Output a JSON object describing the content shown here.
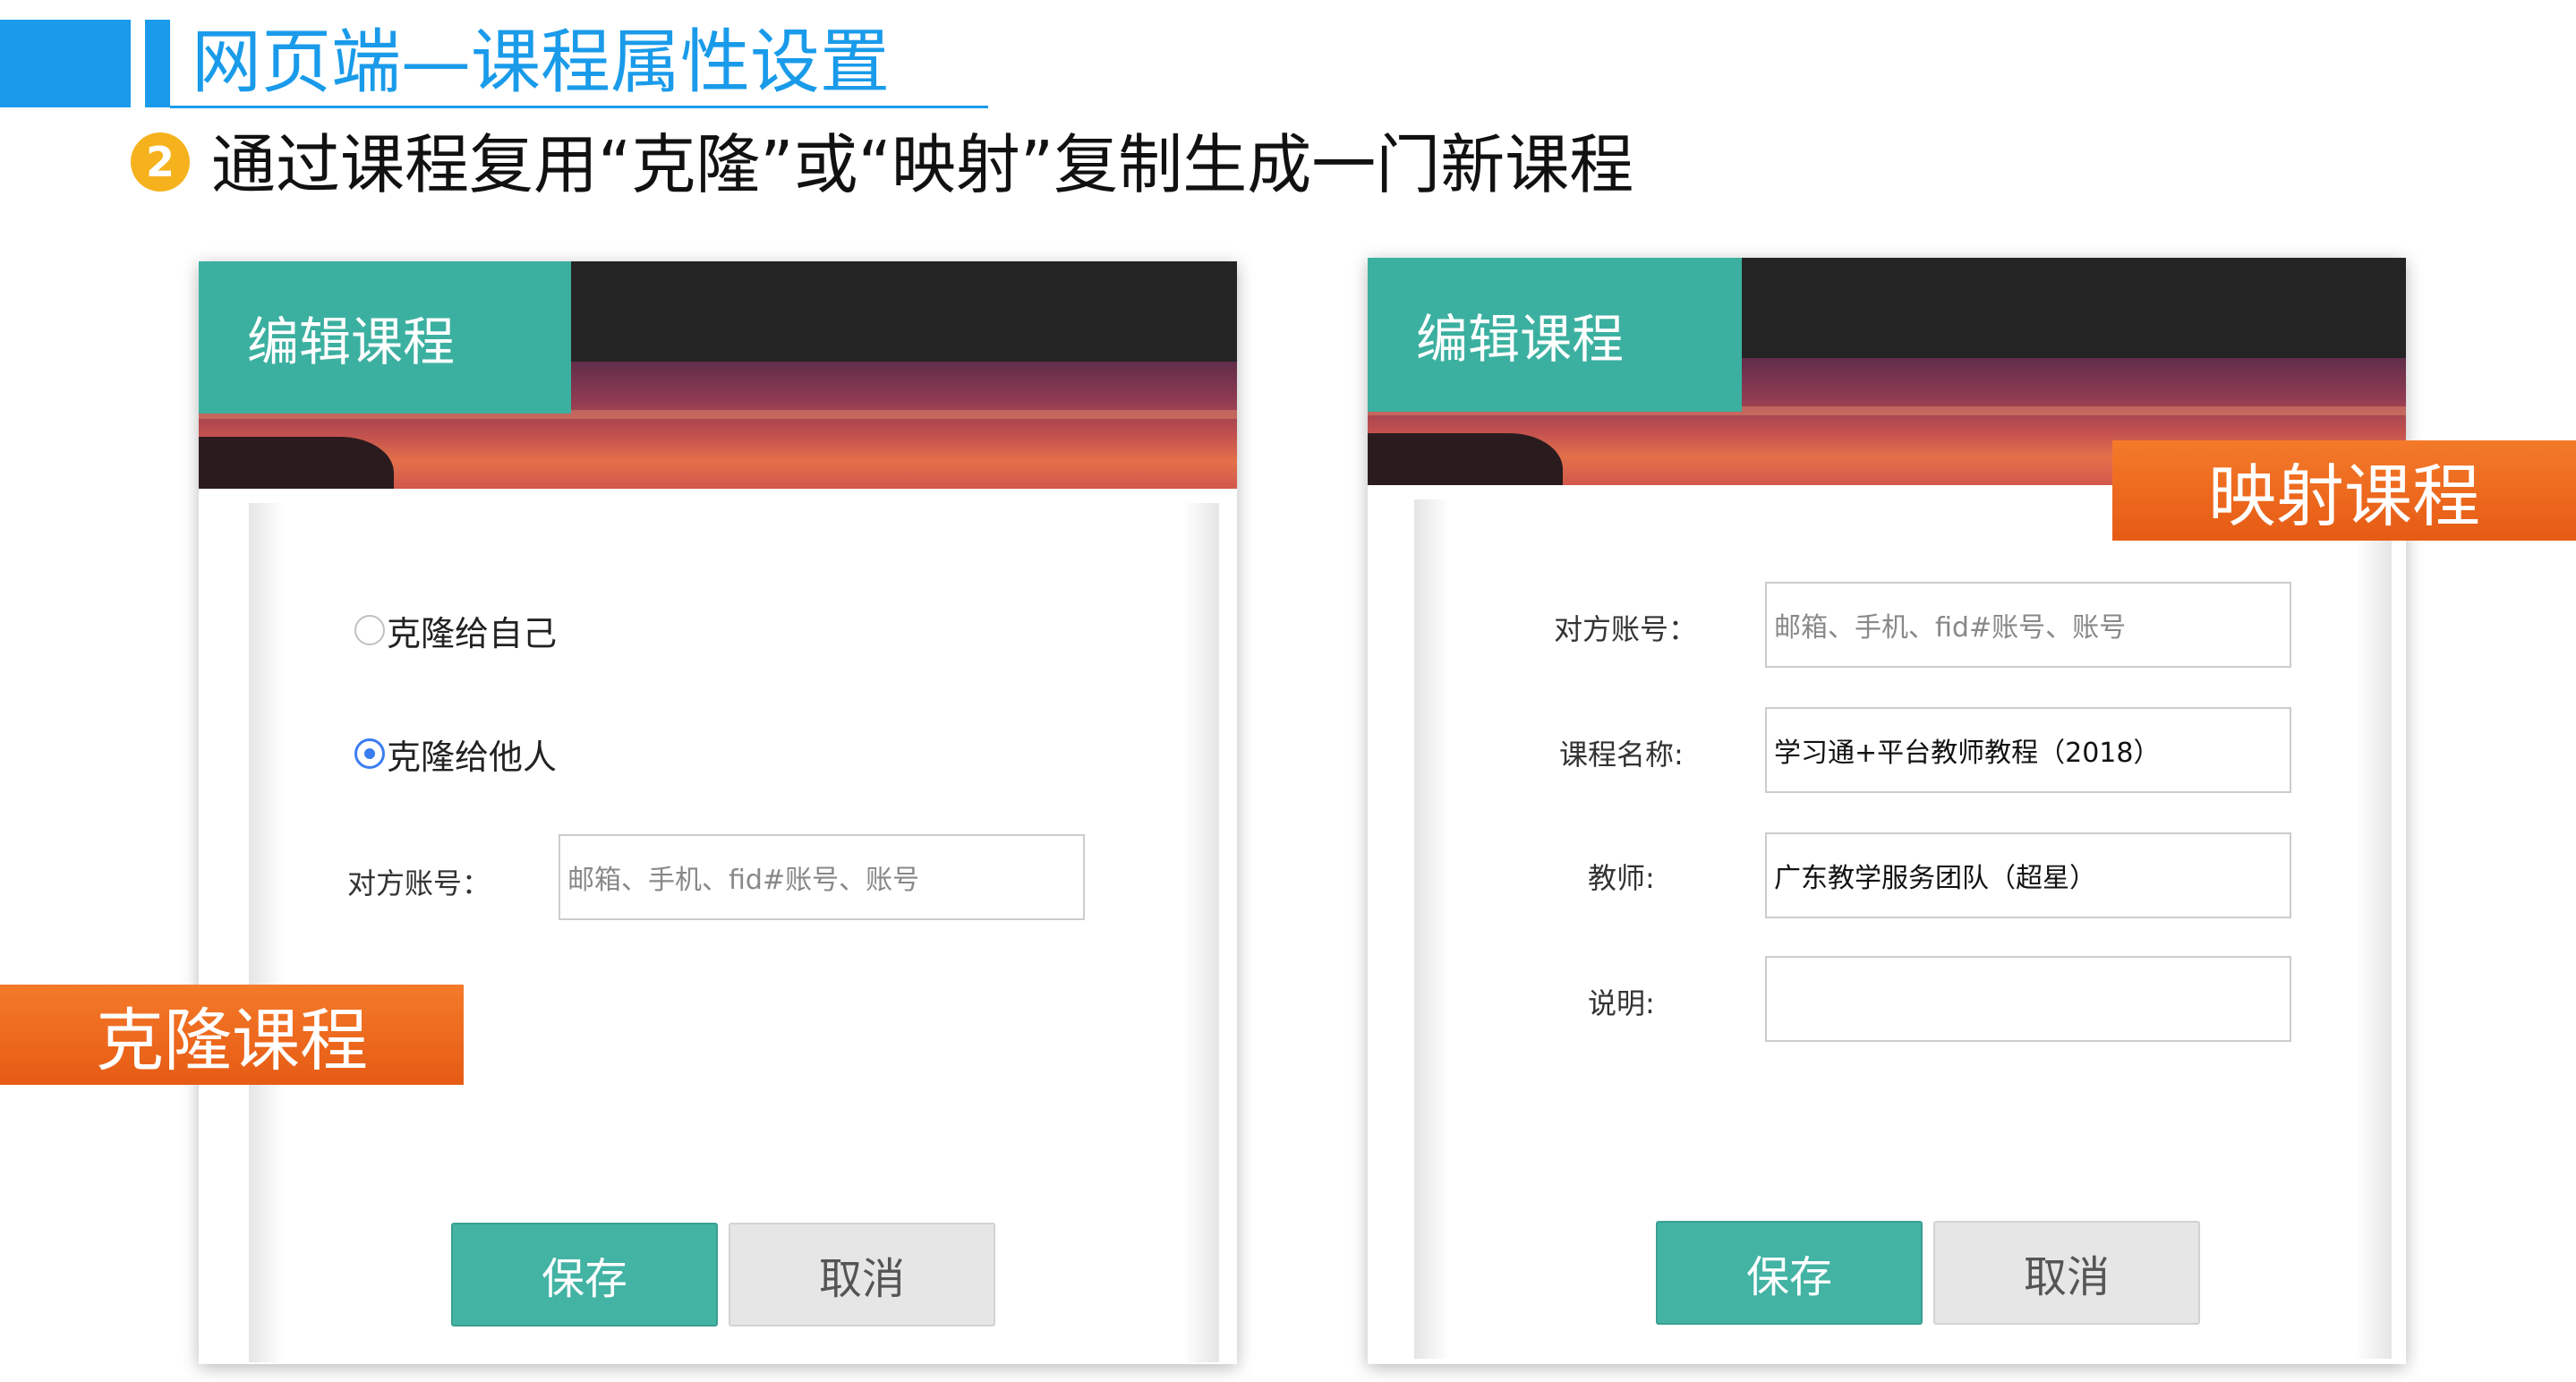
{
  "slide": {
    "title": "网页端—课程属性设置",
    "step_number": "2",
    "step_text": "通过课程复用“克隆”或“映射”复制生成一门新课程",
    "accent_color": "#1a9bea"
  },
  "clone_dialog": {
    "header": "编辑课程",
    "options": [
      {
        "label": "克隆给自己",
        "checked": false
      },
      {
        "label": "克隆给他人",
        "checked": true
      }
    ],
    "account_label": "对方账号：",
    "account_placeholder": "邮箱、手机、fid#账号、账号",
    "save_label": "保存",
    "cancel_label": "取消",
    "callout": "克隆课程"
  },
  "map_dialog": {
    "header": "编辑课程",
    "callout": "映射课程",
    "fields": {
      "account_label": "对方账号：",
      "account_placeholder": "邮箱、手机、fid#账号、账号",
      "course_name_label": "课程名称:",
      "course_name_value": "学习通+平台教师教程（2018）",
      "teacher_label": "教师:",
      "teacher_value": "广东教学服务团队（超星）",
      "description_label": "说明:",
      "description_value": ""
    },
    "save_label": "保存",
    "cancel_label": "取消"
  },
  "colors": {
    "header_teal": "#3cb0a0",
    "save_button": "#43b3a4",
    "callout_orange": "#ee6a1f",
    "badge_yellow": "#f6b21c"
  }
}
